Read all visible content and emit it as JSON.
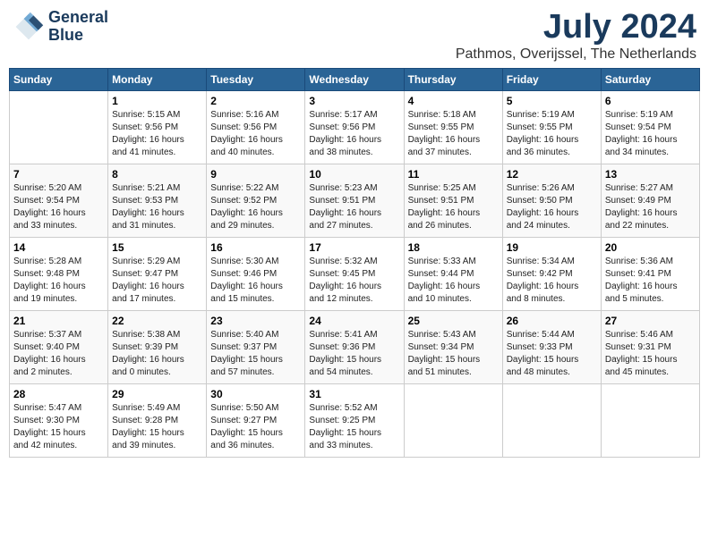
{
  "header": {
    "logo_line1": "General",
    "logo_line2": "Blue",
    "month_year": "July 2024",
    "location": "Pathmos, Overijssel, The Netherlands"
  },
  "weekdays": [
    "Sunday",
    "Monday",
    "Tuesday",
    "Wednesday",
    "Thursday",
    "Friday",
    "Saturday"
  ],
  "weeks": [
    [
      {
        "day": "",
        "info": ""
      },
      {
        "day": "1",
        "info": "Sunrise: 5:15 AM\nSunset: 9:56 PM\nDaylight: 16 hours\nand 41 minutes."
      },
      {
        "day": "2",
        "info": "Sunrise: 5:16 AM\nSunset: 9:56 PM\nDaylight: 16 hours\nand 40 minutes."
      },
      {
        "day": "3",
        "info": "Sunrise: 5:17 AM\nSunset: 9:56 PM\nDaylight: 16 hours\nand 38 minutes."
      },
      {
        "day": "4",
        "info": "Sunrise: 5:18 AM\nSunset: 9:55 PM\nDaylight: 16 hours\nand 37 minutes."
      },
      {
        "day": "5",
        "info": "Sunrise: 5:19 AM\nSunset: 9:55 PM\nDaylight: 16 hours\nand 36 minutes."
      },
      {
        "day": "6",
        "info": "Sunrise: 5:19 AM\nSunset: 9:54 PM\nDaylight: 16 hours\nand 34 minutes."
      }
    ],
    [
      {
        "day": "7",
        "info": "Sunrise: 5:20 AM\nSunset: 9:54 PM\nDaylight: 16 hours\nand 33 minutes."
      },
      {
        "day": "8",
        "info": "Sunrise: 5:21 AM\nSunset: 9:53 PM\nDaylight: 16 hours\nand 31 minutes."
      },
      {
        "day": "9",
        "info": "Sunrise: 5:22 AM\nSunset: 9:52 PM\nDaylight: 16 hours\nand 29 minutes."
      },
      {
        "day": "10",
        "info": "Sunrise: 5:23 AM\nSunset: 9:51 PM\nDaylight: 16 hours\nand 27 minutes."
      },
      {
        "day": "11",
        "info": "Sunrise: 5:25 AM\nSunset: 9:51 PM\nDaylight: 16 hours\nand 26 minutes."
      },
      {
        "day": "12",
        "info": "Sunrise: 5:26 AM\nSunset: 9:50 PM\nDaylight: 16 hours\nand 24 minutes."
      },
      {
        "day": "13",
        "info": "Sunrise: 5:27 AM\nSunset: 9:49 PM\nDaylight: 16 hours\nand 22 minutes."
      }
    ],
    [
      {
        "day": "14",
        "info": "Sunrise: 5:28 AM\nSunset: 9:48 PM\nDaylight: 16 hours\nand 19 minutes."
      },
      {
        "day": "15",
        "info": "Sunrise: 5:29 AM\nSunset: 9:47 PM\nDaylight: 16 hours\nand 17 minutes."
      },
      {
        "day": "16",
        "info": "Sunrise: 5:30 AM\nSunset: 9:46 PM\nDaylight: 16 hours\nand 15 minutes."
      },
      {
        "day": "17",
        "info": "Sunrise: 5:32 AM\nSunset: 9:45 PM\nDaylight: 16 hours\nand 12 minutes."
      },
      {
        "day": "18",
        "info": "Sunrise: 5:33 AM\nSunset: 9:44 PM\nDaylight: 16 hours\nand 10 minutes."
      },
      {
        "day": "19",
        "info": "Sunrise: 5:34 AM\nSunset: 9:42 PM\nDaylight: 16 hours\nand 8 minutes."
      },
      {
        "day": "20",
        "info": "Sunrise: 5:36 AM\nSunset: 9:41 PM\nDaylight: 16 hours\nand 5 minutes."
      }
    ],
    [
      {
        "day": "21",
        "info": "Sunrise: 5:37 AM\nSunset: 9:40 PM\nDaylight: 16 hours\nand 2 minutes."
      },
      {
        "day": "22",
        "info": "Sunrise: 5:38 AM\nSunset: 9:39 PM\nDaylight: 16 hours\nand 0 minutes."
      },
      {
        "day": "23",
        "info": "Sunrise: 5:40 AM\nSunset: 9:37 PM\nDaylight: 15 hours\nand 57 minutes."
      },
      {
        "day": "24",
        "info": "Sunrise: 5:41 AM\nSunset: 9:36 PM\nDaylight: 15 hours\nand 54 minutes."
      },
      {
        "day": "25",
        "info": "Sunrise: 5:43 AM\nSunset: 9:34 PM\nDaylight: 15 hours\nand 51 minutes."
      },
      {
        "day": "26",
        "info": "Sunrise: 5:44 AM\nSunset: 9:33 PM\nDaylight: 15 hours\nand 48 minutes."
      },
      {
        "day": "27",
        "info": "Sunrise: 5:46 AM\nSunset: 9:31 PM\nDaylight: 15 hours\nand 45 minutes."
      }
    ],
    [
      {
        "day": "28",
        "info": "Sunrise: 5:47 AM\nSunset: 9:30 PM\nDaylight: 15 hours\nand 42 minutes."
      },
      {
        "day": "29",
        "info": "Sunrise: 5:49 AM\nSunset: 9:28 PM\nDaylight: 15 hours\nand 39 minutes."
      },
      {
        "day": "30",
        "info": "Sunrise: 5:50 AM\nSunset: 9:27 PM\nDaylight: 15 hours\nand 36 minutes."
      },
      {
        "day": "31",
        "info": "Sunrise: 5:52 AM\nSunset: 9:25 PM\nDaylight: 15 hours\nand 33 minutes."
      },
      {
        "day": "",
        "info": ""
      },
      {
        "day": "",
        "info": ""
      },
      {
        "day": "",
        "info": ""
      }
    ]
  ]
}
